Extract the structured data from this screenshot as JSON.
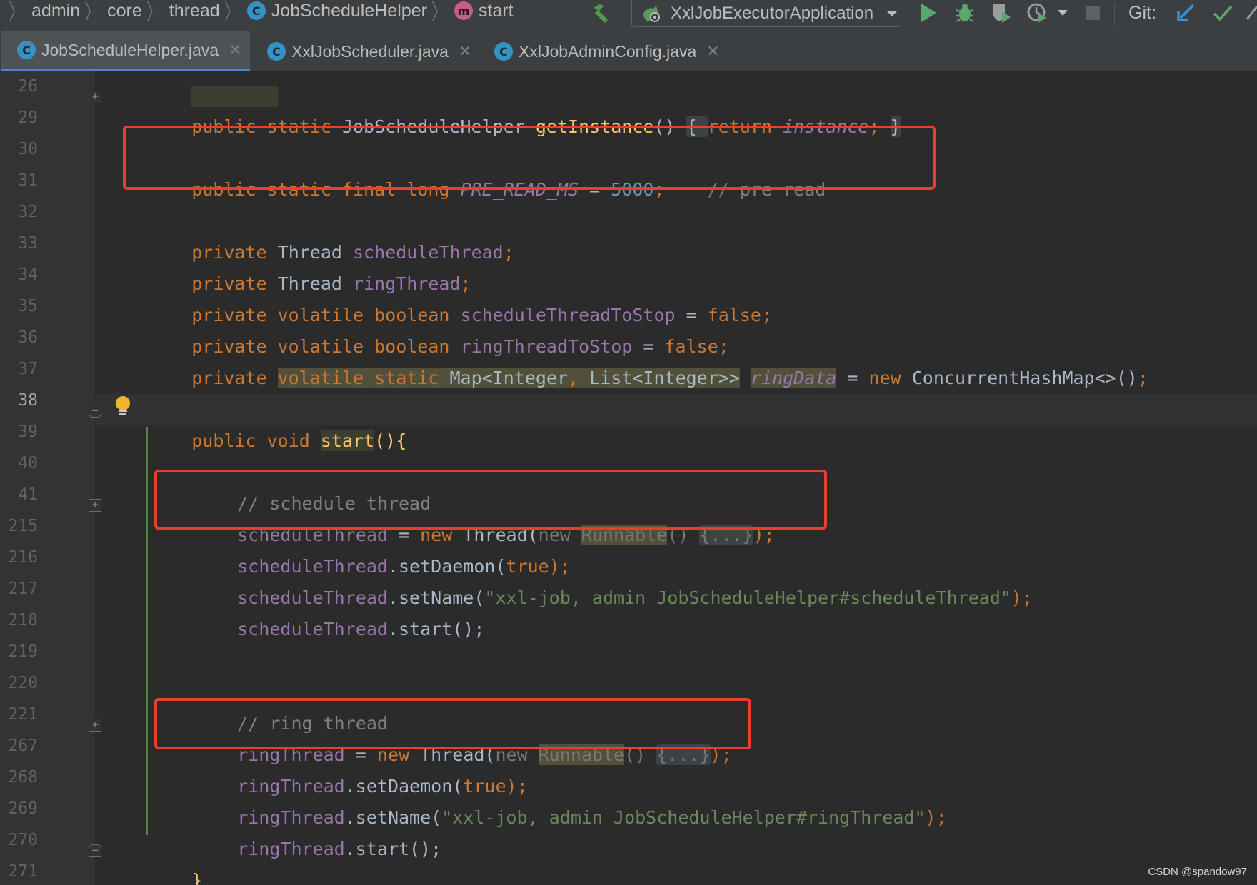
{
  "breadcrumb": {
    "items": [
      "admin",
      "core",
      "thread",
      "JobScheduleHelper",
      "start"
    ]
  },
  "toolbar": {
    "run_config": "XxlJobExecutorApplication",
    "git_label": "Git:"
  },
  "tabs": [
    {
      "label": "JobScheduleHelper.java",
      "active": true
    },
    {
      "label": "XxlJobScheduler.java",
      "active": false
    },
    {
      "label": "XxlJobAdminConfig.java",
      "active": false
    }
  ],
  "editor": {
    "current_line": "38",
    "line_numbers": [
      "26",
      "29",
      "30",
      "31",
      "32",
      "33",
      "34",
      "35",
      "36",
      "37",
      "38",
      "39",
      "40",
      "41",
      "215",
      "216",
      "217",
      "218",
      "219",
      "220",
      "221",
      "267",
      "268",
      "269",
      "270",
      "271"
    ],
    "code": {
      "l26": {
        "kw1": "public static ",
        "type": "JobScheduleHelper ",
        "fn": "getInstance",
        "p1": "() ",
        "b1": "{ ",
        "kw2": "return ",
        "fld": "instance",
        "semi": "; ",
        "b2": "}"
      },
      "l30": {
        "kw": "public static final long ",
        "const": "PRE_READ_MS",
        "eq": " = ",
        "num": "5000",
        "semi": ";",
        "cmt": "    // pre read"
      },
      "l32": {
        "kw": "private ",
        "type": "Thread ",
        "fld": "scheduleThread",
        "semi": ";"
      },
      "l33": {
        "kw": "private ",
        "type": "Thread ",
        "fld": "ringThread",
        "semi": ";"
      },
      "l34": {
        "kw": "private volatile boolean ",
        "fld": "scheduleThreadToStop",
        "eq": " = ",
        "val": "false",
        "semi": ";"
      },
      "l35": {
        "kw": "private volatile boolean ",
        "fld": "ringThreadToStop",
        "eq": " = ",
        "val": "false",
        "semi": ";"
      },
      "l36": {
        "kw": "private ",
        "kw2": "volatile static ",
        "t1": "Map<Integer",
        "comma": ", ",
        "t2": "List<Integer>>",
        "sp": " ",
        "fld": "ringData",
        "eq": " = ",
        "kw3": "new ",
        "t3": "ConcurrentHashMap<>()",
        "semi": ";"
      },
      "l38": {
        "kw": "public void ",
        "fn": "start",
        "rest": "(){"
      },
      "l40": {
        "cmt": "// schedule thread"
      },
      "l41": {
        "fld": "scheduleThread",
        "eq": " = ",
        "kw": "new ",
        "type": "Thread(",
        "new2": "new ",
        "run": "Runnable",
        "paren": "() ",
        "fold": "{...}",
        "end": ");"
      },
      "l215": {
        "fld": "scheduleThread",
        "call": ".setDaemon(",
        "val": "true",
        "end": ");"
      },
      "l216": {
        "fld": "scheduleThread",
        "call": ".setName(",
        "str": "\"xxl-job, admin JobScheduleHelper#scheduleThread\"",
        "end": ");"
      },
      "l217": {
        "fld": "scheduleThread",
        "call": ".start();"
      },
      "l220": {
        "cmt": "// ring thread"
      },
      "l221": {
        "fld": "ringThread",
        "eq": " = ",
        "kw": "new ",
        "type": "Thread(",
        "new2": "new ",
        "run": "Runnable",
        "paren": "() ",
        "fold": "{...}",
        "end": ");"
      },
      "l267": {
        "fld": "ringThread",
        "call": ".setDaemon(",
        "val": "true",
        "end": ");"
      },
      "l268": {
        "fld": "ringThread",
        "call": ".setName(",
        "str": "\"xxl-job, admin JobScheduleHelper#ringThread\"",
        "end": ");"
      },
      "l269": {
        "fld": "ringThread",
        "call": ".start();"
      },
      "l270": {
        "brace": "}"
      }
    }
  },
  "watermark": "CSDN @spandow97",
  "colors": {
    "accent": "#4a88c7",
    "annotation_red": "#e8402c",
    "keyword": "#cc7832",
    "field": "#9876aa",
    "function": "#ffc66d",
    "number": "#6897bb",
    "string": "#6a8759",
    "comment": "#808080"
  },
  "icons": [
    "chevron-right-icon",
    "class-icon",
    "method-icon",
    "hammer-icon",
    "run-config-icon",
    "dropdown-icon",
    "run-icon",
    "debug-icon",
    "coverage-icon",
    "profile-icon",
    "stop-icon",
    "git-update-icon",
    "git-commit-icon",
    "bulb-icon",
    "fold-icon"
  ]
}
